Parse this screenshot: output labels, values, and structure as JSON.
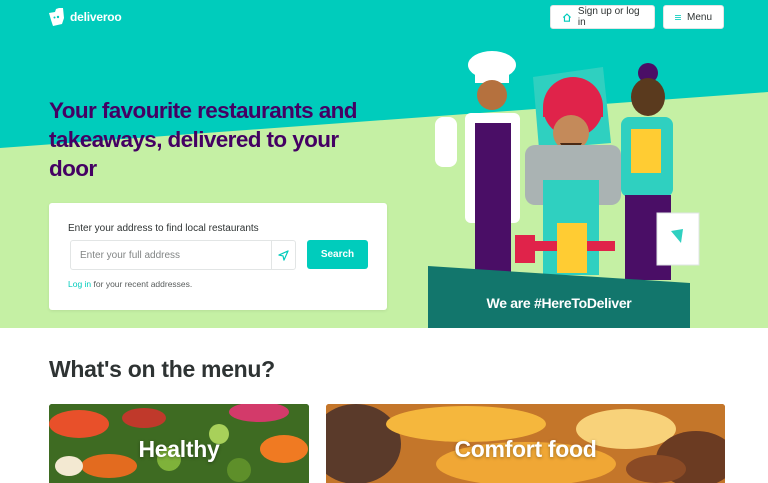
{
  "brand": {
    "name": "deliveroo",
    "color": "#00ccbc",
    "hero_light": "#c5f0a4",
    "headline_color": "#440063"
  },
  "header": {
    "signup_label": "Sign up or log in",
    "menu_label": "Menu"
  },
  "hero": {
    "headline": "Your favourite restaurants and takeaways, delivered to your door",
    "card_prompt": "Enter your address to find local restaurants",
    "address_placeholder": "Enter your full address",
    "search_label": "Search",
    "login_link": "Log in",
    "login_suffix": " for your recent addresses.",
    "banner": "We are #HereToDeliver"
  },
  "menu_section": {
    "title": "What's on the menu?",
    "tiles": [
      {
        "label": "Healthy"
      },
      {
        "label": "Comfort food"
      }
    ]
  },
  "icons": [
    "deliveroo-logo-icon",
    "home-icon",
    "hamburger-menu-icon",
    "location-arrow-icon"
  ]
}
